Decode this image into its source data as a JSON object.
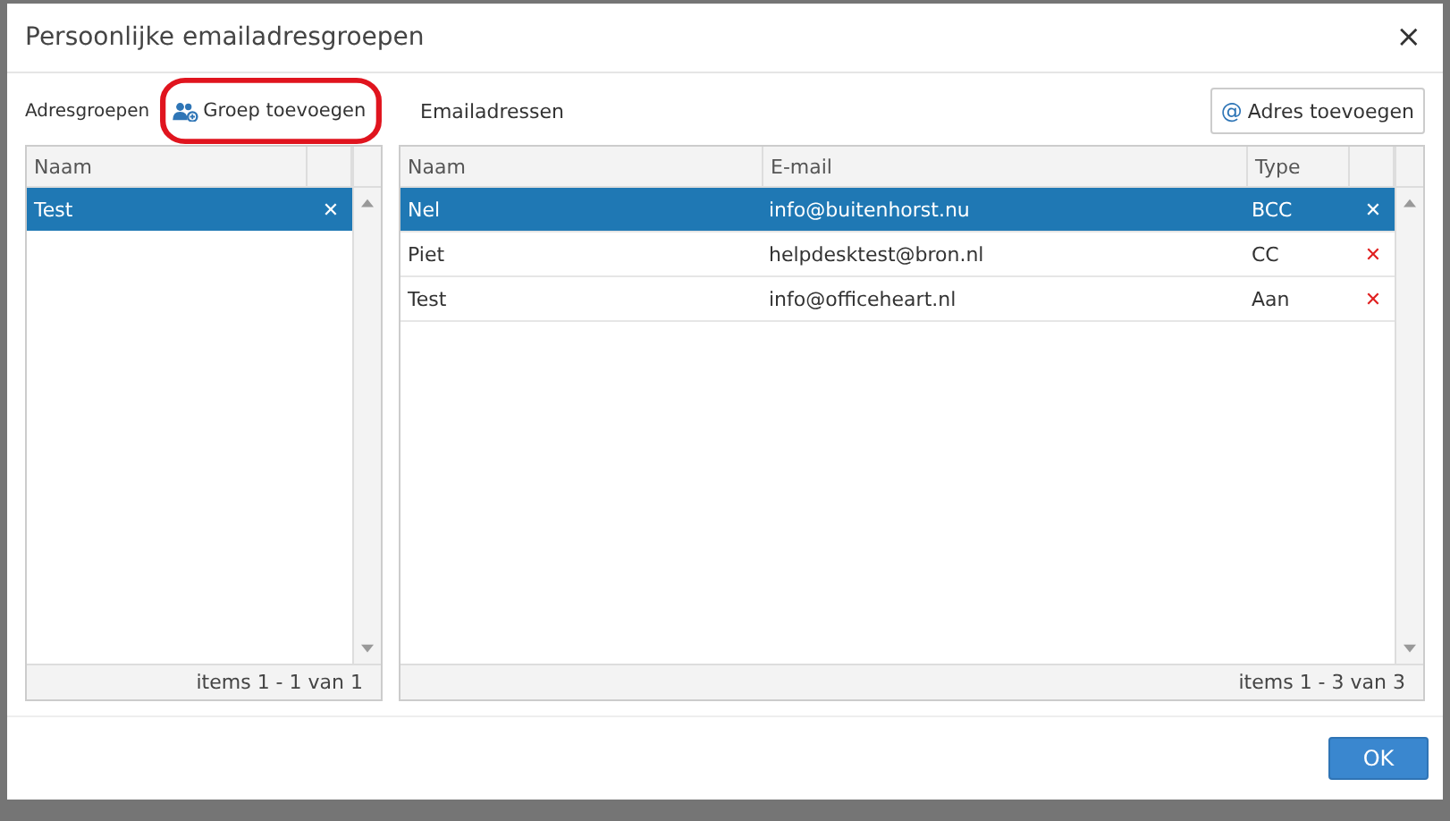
{
  "window": {
    "title": "Persoonlijke emailadresgroepen",
    "close": "×"
  },
  "groups": {
    "label": "Adresgroepen",
    "add_button": "Groep toevoegen",
    "columns": [
      "Naam"
    ],
    "rows": [
      {
        "name": "Test",
        "delete": "✕",
        "selected": true
      }
    ],
    "footer": "items 1 - 1 van 1"
  },
  "addresses": {
    "label": "Emailadressen",
    "add_button": "Adres toevoegen",
    "add_icon": "@",
    "columns": [
      "Naam",
      "E-mail",
      "Type"
    ],
    "rows": [
      {
        "name": "Nel",
        "email": "info@buitenhorst.nu",
        "type": "BCC",
        "delete": "✕",
        "selected": true
      },
      {
        "name": "Piet",
        "email": "helpdesktest@bron.nl",
        "type": "CC",
        "delete": "✕",
        "selected": false
      },
      {
        "name": "Test",
        "email": "info@officeheart.nl",
        "type": "Aan",
        "delete": "✕",
        "selected": false
      }
    ],
    "footer": "items 1 - 3 van 3"
  },
  "buttons": [
    "OK"
  ]
}
